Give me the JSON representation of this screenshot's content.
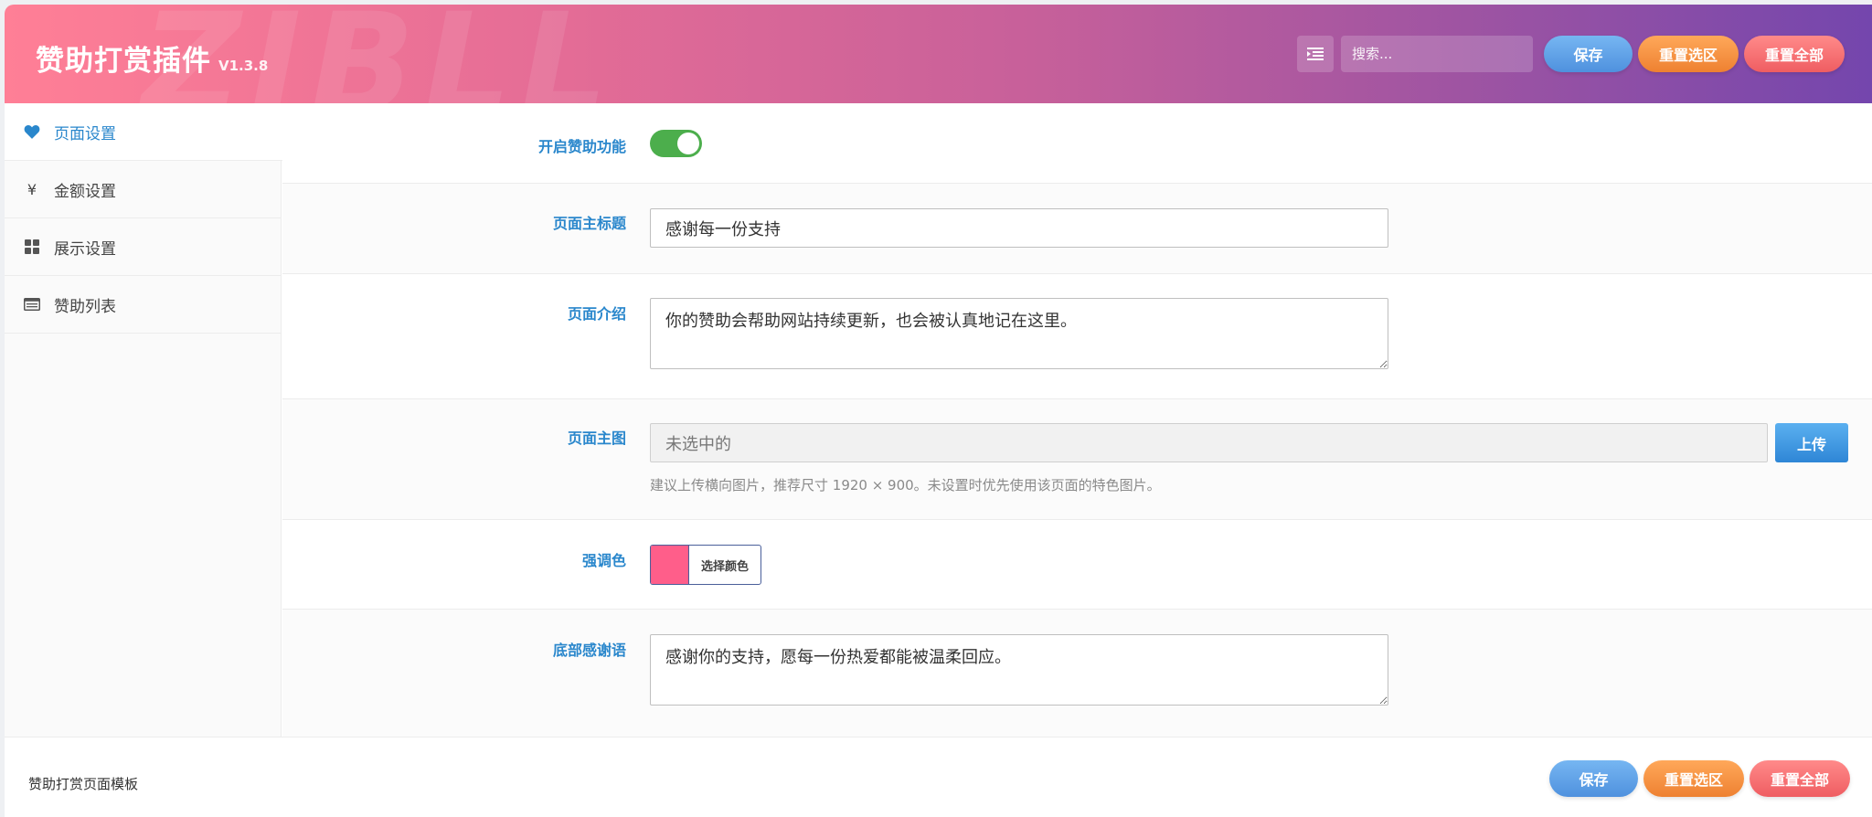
{
  "header": {
    "watermark": "ZIBLL",
    "title": "赞助打赏插件",
    "version": "V1.3.8",
    "search_placeholder": "搜索...",
    "save_label": "保存",
    "reset_section_label": "重置选区",
    "reset_all_label": "重置全部"
  },
  "sidebar": {
    "items": [
      {
        "label": "页面设置",
        "icon": "heart-icon",
        "active": true
      },
      {
        "label": "金额设置",
        "icon": "yen-icon",
        "active": false
      },
      {
        "label": "展示设置",
        "icon": "grid-icon",
        "active": false
      },
      {
        "label": "赞助列表",
        "icon": "list-icon",
        "active": false
      }
    ]
  },
  "form": {
    "enable": {
      "label": "开启赞助功能",
      "value": true
    },
    "page_title": {
      "label": "页面主标题",
      "value": "感谢每一份支持"
    },
    "intro": {
      "label": "页面介绍",
      "value": "你的赞助会帮助网站持续更新，也会被认真地记在这里。"
    },
    "main_image": {
      "label": "页面主图",
      "placeholder": "未选中的",
      "upload_label": "上传",
      "hint": "建议上传横向图片，推荐尺寸 1920 × 900。未设置时优先使用该页面的特色图片。"
    },
    "accent_color": {
      "label": "强调色",
      "value": "#ff5e8a",
      "button_label": "选择颜色"
    },
    "thanks": {
      "label": "底部感谢语",
      "value": "感谢你的支持，愿每一份热爱都能被温柔回应。"
    }
  },
  "footer": {
    "text": "赞助打赏页面模板",
    "save_label": "保存",
    "reset_section_label": "重置选区",
    "reset_all_label": "重置全部"
  }
}
